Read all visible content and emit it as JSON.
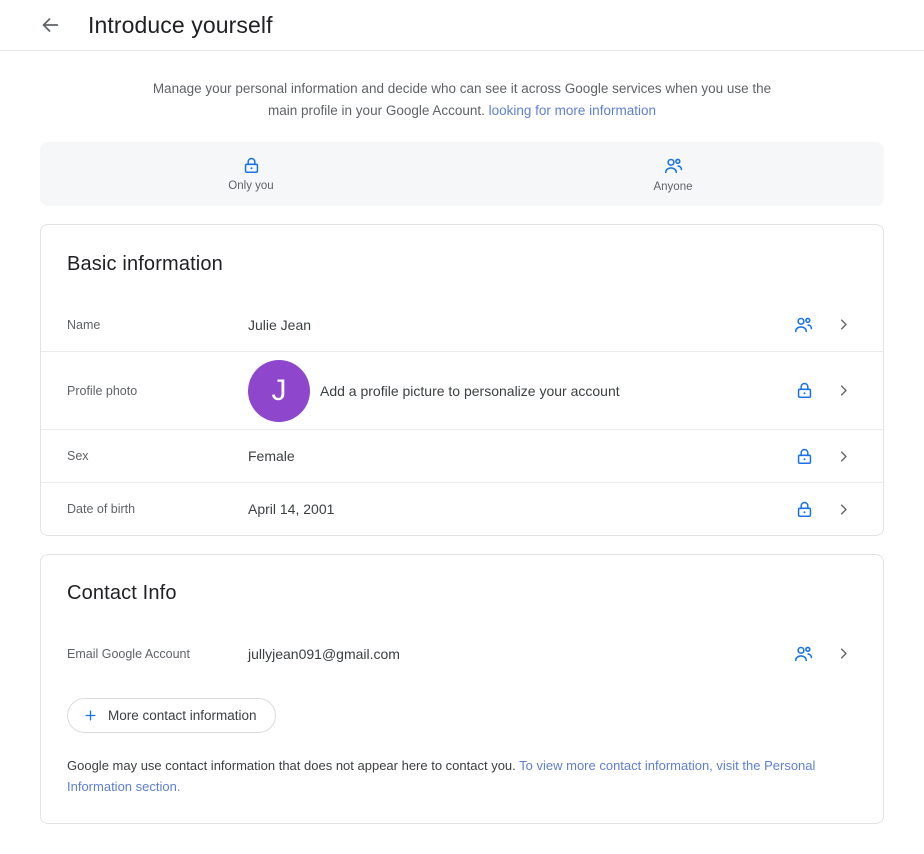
{
  "header": {
    "back_icon": "arrow-left-icon",
    "title": "Introduce yourself"
  },
  "subtitle": {
    "text": "Manage your personal information and decide who can see it across Google services when you use the main profile in your Google Account. ",
    "link": "looking for more information"
  },
  "visibility_tabs": [
    {
      "icon": "lock-icon",
      "label": "Only you"
    },
    {
      "icon": "people-icon",
      "label": "Anyone"
    }
  ],
  "basic_information": {
    "title": "Basic information",
    "rows": [
      {
        "label": "Name",
        "value": "Julie Jean",
        "visibility_icon": "people-icon",
        "chevron": "chevron-right-icon"
      },
      {
        "label": "Profile photo",
        "value": "Add a profile picture to personalize your account",
        "avatar_initial": "J",
        "visibility_icon": "lock-icon",
        "chevron": "chevron-right-icon"
      },
      {
        "label": "Sex",
        "value": "Female",
        "visibility_icon": "lock-icon",
        "chevron": "chevron-right-icon"
      },
      {
        "label": "Date of birth",
        "value": "April 14, 2001",
        "visibility_icon": "lock-icon",
        "chevron": "chevron-right-icon"
      }
    ]
  },
  "contact_info": {
    "title": "Contact Info",
    "rows": [
      {
        "label": "Email Google Account",
        "value": "jullyjean091@gmail.com",
        "visibility_icon": "people-icon",
        "chevron": "chevron-right-icon"
      }
    ],
    "more_button": {
      "icon": "plus-icon",
      "label": "More contact information"
    },
    "footnote": {
      "text": "Google may use contact information that does not appear here to contact you. ",
      "link": "To view more contact information, visit the Personal Information section."
    }
  },
  "colors": {
    "accent_blue": "#1a73e8",
    "link_blue": "#5e7fd4",
    "avatar_purple": "#8e47cc",
    "text_primary": "#3c4043",
    "text_secondary": "#5f6368",
    "tabbar_bg": "#f6f7f9",
    "card_border": "#e3e3e3"
  }
}
